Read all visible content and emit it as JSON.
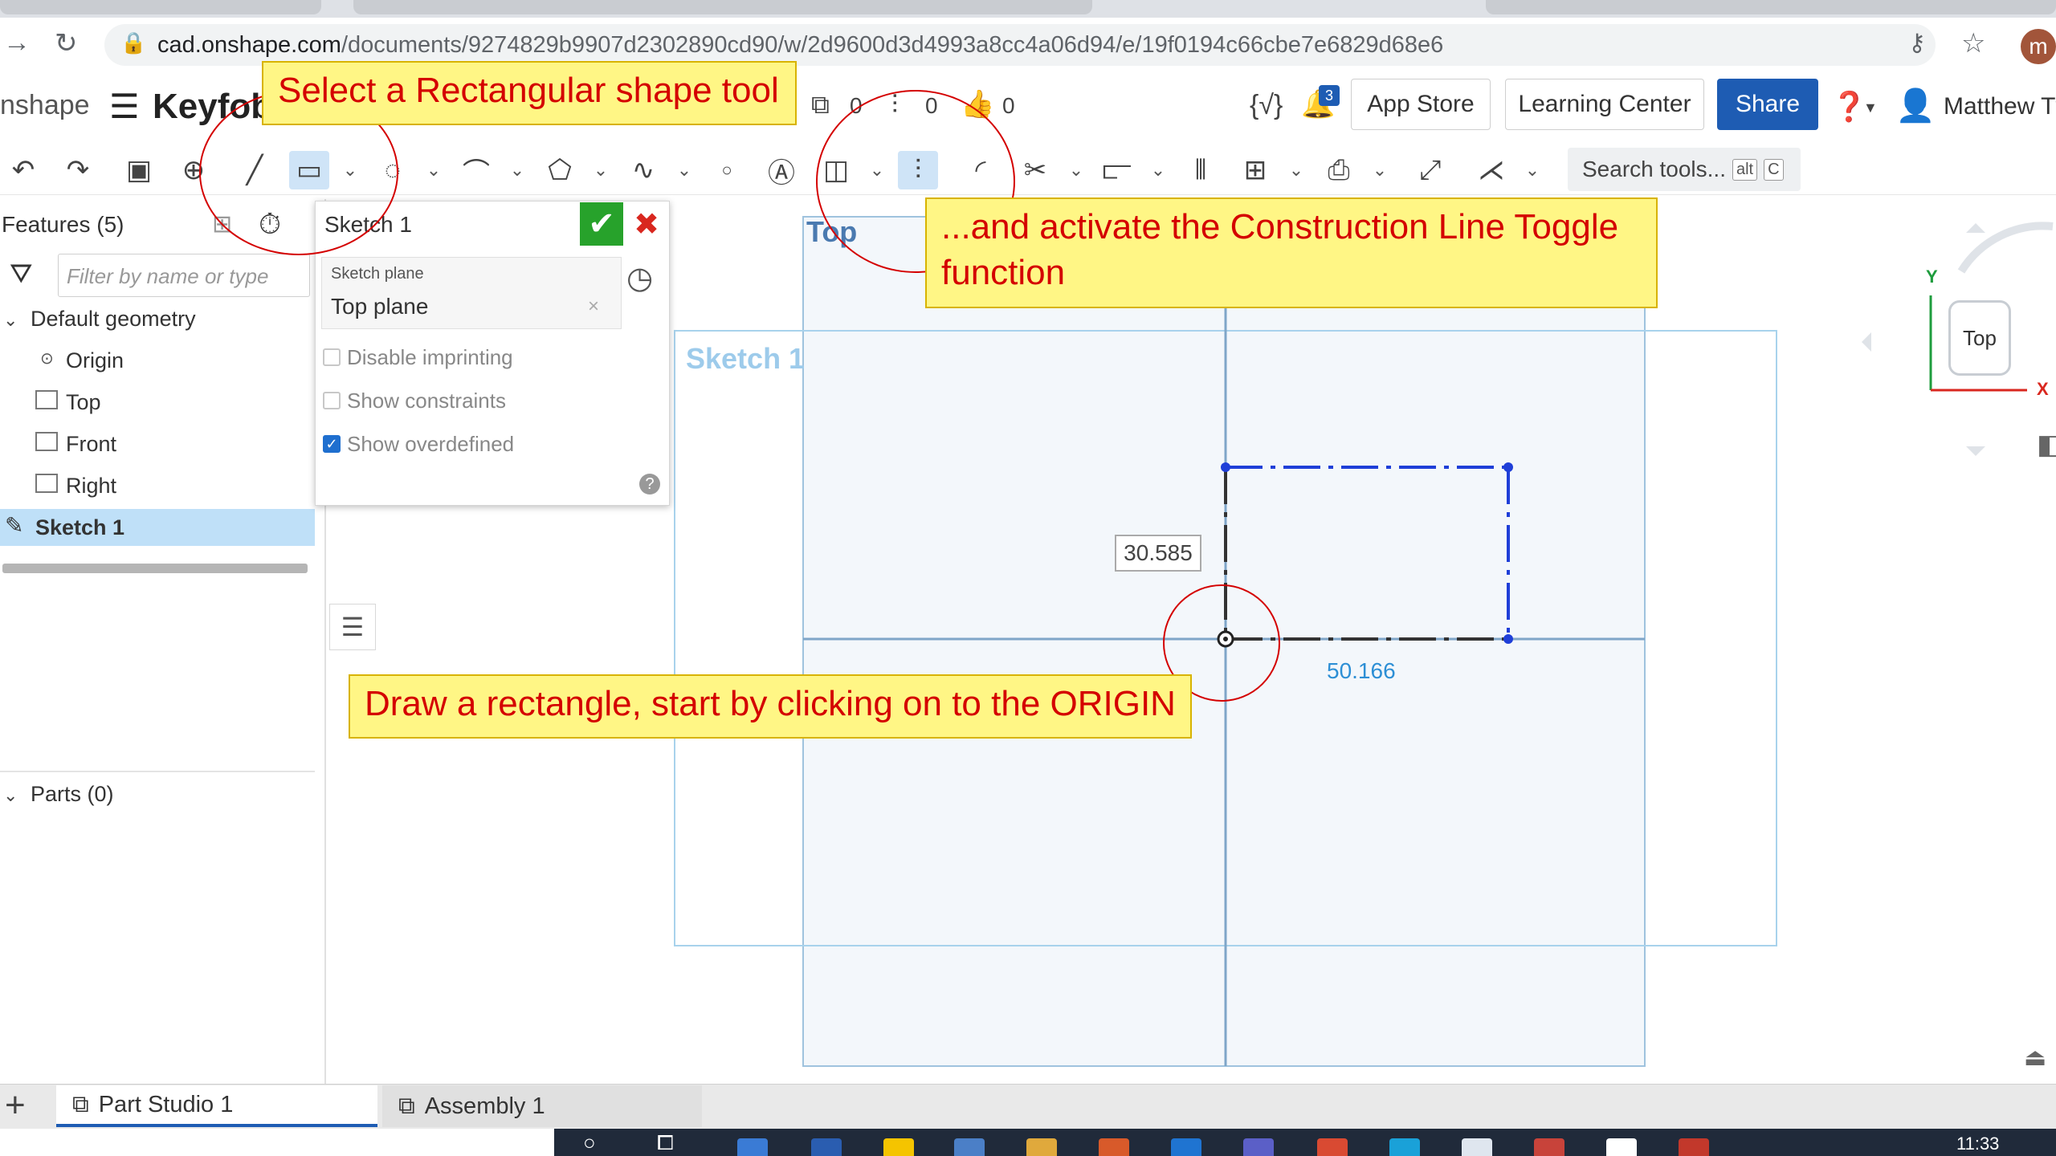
{
  "browser": {
    "url_host": "cad.onshape.com",
    "url_path": "/documents/9274829b9907d2302890cd90/w/2d9600d3d4993a8cc4a06d94/e/19f0194c66cbe7e6829d68e6",
    "profile_initial": "m"
  },
  "header": {
    "brand": "nshape",
    "doc_title": "Keyfob",
    "counts": [
      "0",
      "0",
      "0"
    ],
    "notifications": "3",
    "app_store": "App Store",
    "learning_center": "Learning Center",
    "share": "Share",
    "user_name": "Matthew Tv"
  },
  "toolbar": {
    "search_label": "Search tools...",
    "search_kbd_1": "alt",
    "search_kbd_2": "C"
  },
  "features": {
    "title": "Features (5)",
    "filter_placeholder": "Filter by name or type",
    "default_geometry": "Default geometry",
    "items": [
      "Origin",
      "Top",
      "Front",
      "Right"
    ],
    "sketch": "Sketch 1",
    "parts": "Parts (0)"
  },
  "sketch_dialog": {
    "title": "Sketch 1",
    "plane_label": "Sketch plane",
    "plane_value": "Top plane",
    "options": [
      {
        "label": "Disable imprinting",
        "checked": false
      },
      {
        "label": "Show constraints",
        "checked": false
      },
      {
        "label": "Show overdefined",
        "checked": true
      }
    ]
  },
  "canvas": {
    "plane_label": "Top",
    "sketch_label": "Sketch 1",
    "dim_vertical": "30.585",
    "dim_horizontal": "50.166",
    "viewcube_label": "Top",
    "axis_y": "Y",
    "axis_x": "X"
  },
  "tips": {
    "tool": "Select a Rectangular shape tool",
    "construction": "...and activate the Construction Line Toggle function",
    "draw": "Draw a rectangle, start by clicking on to the ORIGIN"
  },
  "tabs": {
    "add": "+",
    "part_studio": "Part Studio 1",
    "assembly": "Assembly 1"
  },
  "taskbar": {
    "time": "11:33"
  },
  "colors": {
    "accent": "#1e5cb3",
    "sketch_blue": "#1f3fd8",
    "tip_bg": "#fff685",
    "tip_text": "#d40000"
  }
}
